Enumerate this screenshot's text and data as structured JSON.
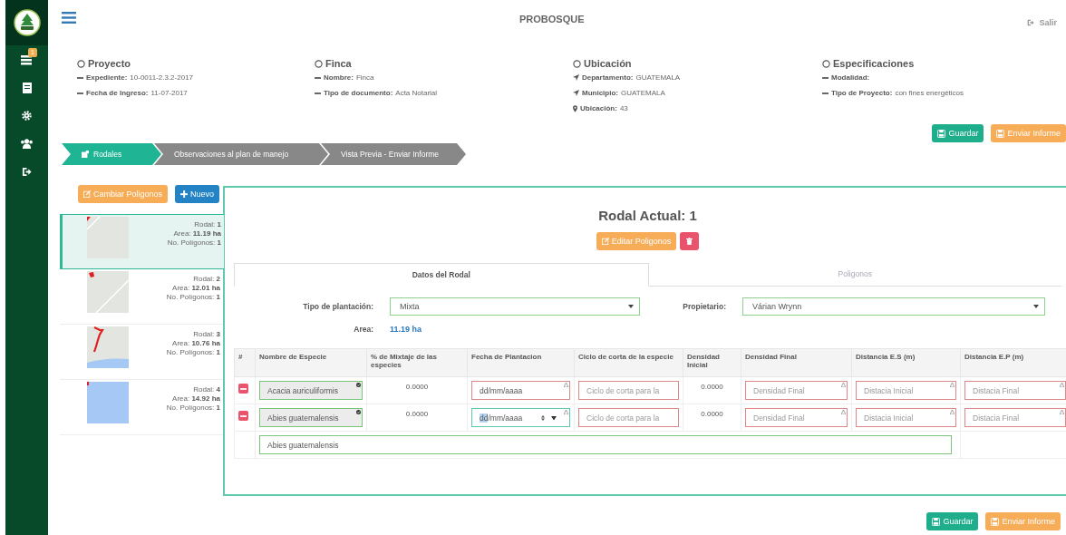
{
  "app": {
    "title": "PROBOSQUE",
    "logout": "Salir"
  },
  "sidebar": {
    "items": [
      {
        "kind": "list",
        "badge": "1"
      },
      {
        "kind": "document"
      },
      {
        "kind": "gear"
      },
      {
        "kind": "users"
      },
      {
        "kind": "sign-out"
      }
    ]
  },
  "summary": [
    {
      "title": "Proyecto",
      "fields": [
        {
          "kind": "dash",
          "label": "Expediente:",
          "value": "10-0011-2.3.2-2017"
        },
        {
          "kind": "dash",
          "label": "Fecha de Ingreso:",
          "value": "11-07-2017"
        }
      ]
    },
    {
      "title": "Finca",
      "fields": [
        {
          "kind": "dash",
          "label": "Nombre:",
          "value": "Finca"
        },
        {
          "kind": "dash",
          "label": "Tipo de documento:",
          "value": "Acta Notarial"
        }
      ]
    },
    {
      "title": "Ubicación",
      "fields": [
        {
          "kind": "arrow",
          "label": "Departamento:",
          "value": "GUATEMALA"
        },
        {
          "kind": "arrow",
          "label": "Municipio:",
          "value": "GUATEMALA"
        },
        {
          "kind": "pin",
          "label": "Ubicación:",
          "value": "43"
        }
      ]
    },
    {
      "title": "Especificaciones",
      "fields": [
        {
          "kind": "dash",
          "label": "Modalidad:"
        },
        {
          "kind": "dash",
          "label": "Tipo de Proyecto:",
          "value": "con fines energéticos"
        }
      ]
    }
  ],
  "top_actions": [
    {
      "kind": "save",
      "label": "Guardar"
    },
    {
      "kind": "send",
      "label": "Enviar Informe"
    }
  ],
  "steps": [
    {
      "label": "Rodales",
      "selected": true
    },
    {
      "label": "Observaciones al plan de manejo",
      "selected": false
    },
    {
      "label": "Vista Previa - Enviar Informe",
      "selected": false
    }
  ],
  "rodal_toolbar": [
    {
      "kind": "edit",
      "label": "Cambiar Poligonos"
    },
    {
      "kind": "new",
      "label": "Nuevo"
    }
  ],
  "rodales": [
    {
      "kind": "road",
      "rodal_label": "Rodal:",
      "rodal": "1",
      "area_label": "Area:",
      "area": "11.19 ha",
      "poly_label": "No. Polígonos:",
      "poly": "1",
      "selected": true
    },
    {
      "kind": "road-shape",
      "rodal_label": "Rodal:",
      "rodal": "2",
      "area_label": "Area:",
      "area": "12.01 ha",
      "poly_label": "No. Polígonos:",
      "poly": "1",
      "selected": false
    },
    {
      "kind": "trail",
      "rodal_label": "Rodal:",
      "rodal": "3",
      "area_label": "Area:",
      "area": "10.76 ha",
      "poly_label": "No. Polígonos:",
      "poly": "1",
      "selected": false
    },
    {
      "kind": "water",
      "rodal_label": "Rodal:",
      "rodal": "4",
      "area_label": "Area:",
      "area": "14.92 ha",
      "poly_label": "No. Polígonos:",
      "poly": "1",
      "selected": false
    }
  ],
  "detail": {
    "title": "Rodal Actual: 1",
    "buttons": [
      {
        "kind": "edit",
        "label": "Editar Poligonos"
      },
      {
        "kind": "delete"
      }
    ],
    "tabs": [
      {
        "label": "Datos del Rodal",
        "selected": true
      },
      {
        "label": "Poligonos",
        "selected": false
      }
    ],
    "tipo": {
      "label": "Tipo de plantación:",
      "value": "Mixta"
    },
    "propietario": {
      "label": "Propietario:",
      "value": "Várian Wrynn"
    },
    "area": {
      "label": "Area:",
      "value": "11.19 ha"
    },
    "table": {
      "columns": [
        "#",
        "Nombre de Especie",
        "% de Mixtaje de las especies",
        "Fecha de Plantacion",
        "Ciclo de corta de la especie",
        "Densidad Inicial",
        "Densidad Final",
        "Distancia E.S (m)",
        "Distancia E.P (m)"
      ],
      "rows": [
        {
          "species": "Acacia auriculiformis",
          "mix": "0.0000",
          "date": "dd/mm/aaaa",
          "date_focused": false,
          "ciclo": "Ciclo de corta para la",
          "densidad_inicial": "0.0000",
          "densidad_final": "Densidad Final",
          "dist_es": "Distacia Inicial",
          "dist_ep": "Distacia Final"
        },
        {
          "species": "Abies guatemalensis",
          "mix": "0.0000",
          "date": "dd/mm/aaaa",
          "date_focused": true,
          "ciclo": "Ciclo de corta para la",
          "densidad_inicial": "0.0000",
          "densidad_final": "Densidad Final",
          "dist_es": "Distacia Inicial",
          "dist_ep": "Distacia Final"
        }
      ],
      "species_search": "Abies guatemalensis"
    }
  },
  "bottom_actions": [
    {
      "kind": "save",
      "label": "Guardar"
    },
    {
      "kind": "send",
      "label": "Enviar Informe"
    }
  ]
}
